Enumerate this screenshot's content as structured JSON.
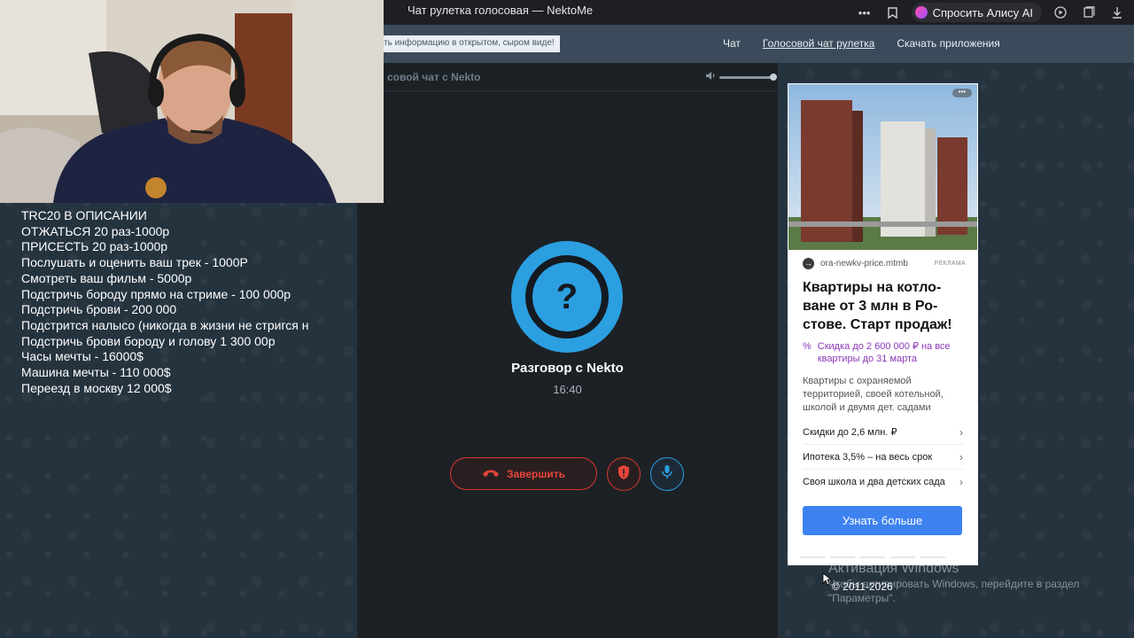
{
  "browser": {
    "tab_title": "Чат рулетка голосовая — NektoMe",
    "alice_label": "Спросить Алису AI"
  },
  "site": {
    "notice": "ть информацию в открытом, сыром виде!",
    "nav": [
      {
        "label": "Чат"
      },
      {
        "label": "Голосовой чат рулетка"
      },
      {
        "label": "Скачать приложения"
      }
    ]
  },
  "chat": {
    "panel_title": "совой чат с Nekto",
    "volume_level": 1.0,
    "avatar_glyph": "?",
    "conversation_title": "Разговор с Nekto",
    "timer": "16:40",
    "end_label": "Завершить"
  },
  "stream_overlay": {
    "lines": [
      "TRC20 В ОПИСАНИИ",
      "ОТЖАТЬСЯ 20 раз-1000р",
      "ПРИСЕСТЬ 20 раз-1000р",
      "Послушать и оценить ваш трек - 1000Р",
      "Смотреть ваш фильм - 5000р",
      "Подстричь бороду прямо на стриме - 100 000р",
      "Подстричь брови - 200 000",
      "Подстрится налысо (никогда в жизни не стригся н",
      "Подстричь брови бороду и голову 1 300 00р",
      "Часы мечты - 16000$",
      "Машина мечты - 110 000$",
      "Переезд в москву 12 000$"
    ]
  },
  "ad": {
    "url": "ora-newkv-price.mtmb",
    "badge": "РЕКЛАМА",
    "title": "Квартиры на котло-ване от 3 млн в Ро-стове. Старт продаж!",
    "promo": "Скидка до 2 600 000 ₽ на все квартиры до 31 марта",
    "description": "Квартиры с охраняемой территорией, своей котельной, школой и двумя дет. садами",
    "items": [
      {
        "label": "Скидки до 2,6 млн. ₽"
      },
      {
        "label": "Ипотека 3,5% – на весь срок"
      },
      {
        "label": "Своя школа и два детских сада"
      }
    ],
    "cta": "Узнать больше"
  },
  "footer": {
    "copyright": "© 2011-2026"
  },
  "windows_watermark": {
    "title": "Активация Windows",
    "subtitle": "Чтобы активировать Windows, перейдите в раздел \"Параметры\"."
  },
  "colors": {
    "accent_blue": "#2b9fe0",
    "end_red": "#d8382f",
    "ad_cta": "#3d82f0",
    "promo_purple": "#8a38b8"
  }
}
